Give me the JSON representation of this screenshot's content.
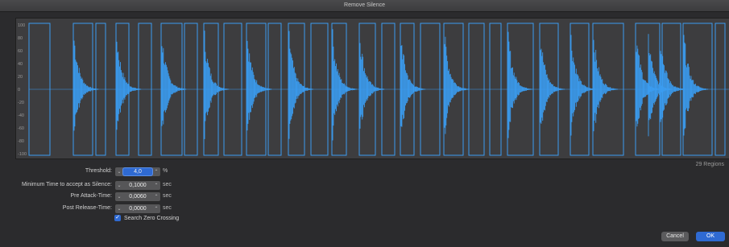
{
  "window": {
    "title": "Remove Silence"
  },
  "waveform": {
    "y_ticks": [
      "100",
      "80",
      "60",
      "40",
      "20",
      "0",
      "-20",
      "-40",
      "-60",
      "-80",
      "-100"
    ],
    "accent_color": "#3b9cf0",
    "regions_label": "29 Regions"
  },
  "form": {
    "threshold": {
      "label": "Threshold:",
      "value": "4,0",
      "unit": "%"
    },
    "min_time": {
      "label": "Minimum Time to accept as Silence:",
      "value": "0,1000",
      "unit": "sec"
    },
    "pre_attack": {
      "label": "Pre Attack-Time:",
      "value": "0,0060",
      "unit": "sec"
    },
    "post_release": {
      "label": "Post Release-Time:",
      "value": "0,0000",
      "unit": "sec"
    },
    "zero_crossing": {
      "label": "Search Zero Crossing",
      "checked": true
    }
  },
  "buttons": {
    "cancel": "Cancel",
    "ok": "OK"
  },
  "icons": {
    "decrement": "chevron-down-icon",
    "increment": "chevron-up-icon",
    "check": "checkmark-icon"
  }
}
